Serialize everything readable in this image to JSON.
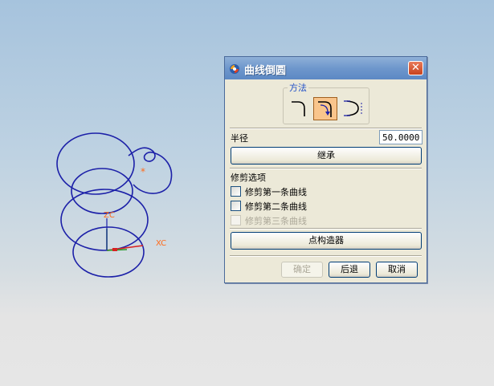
{
  "viewport": {
    "triad_label": "ZC",
    "xc_label": "XC",
    "curve_color": "#1c20a8",
    "triad_colors": {
      "x": "#d82020",
      "y": "#2a9a2a",
      "z": "#1c20a8",
      "label": "#ff6a1a"
    }
  },
  "dialog": {
    "title": "曲线倒圆",
    "title_icon": "app-icon",
    "close_icon": "close-icon",
    "method_group": {
      "label": "方法",
      "options": [
        {
          "name": "simple-fillet-icon",
          "selected": false
        },
        {
          "name": "two-curve-fillet-icon",
          "selected": true
        },
        {
          "name": "three-curve-fillet-icon",
          "selected": false
        }
      ]
    },
    "radius_label": "半径",
    "radius_value": "50.0000",
    "inherit_button": "继承",
    "trim_options_label": "修剪选项",
    "trim_options": [
      {
        "label": "修剪第一条曲线",
        "checked": false,
        "enabled": true
      },
      {
        "label": "修剪第二条曲线",
        "checked": false,
        "enabled": true
      },
      {
        "label": "修剪第三条曲线",
        "checked": false,
        "enabled": false
      }
    ],
    "point_constructor_button": "点构造器",
    "ok_button": "确定",
    "back_button": "后退",
    "cancel_button": "取消",
    "accent_color": "#5c88c4"
  }
}
